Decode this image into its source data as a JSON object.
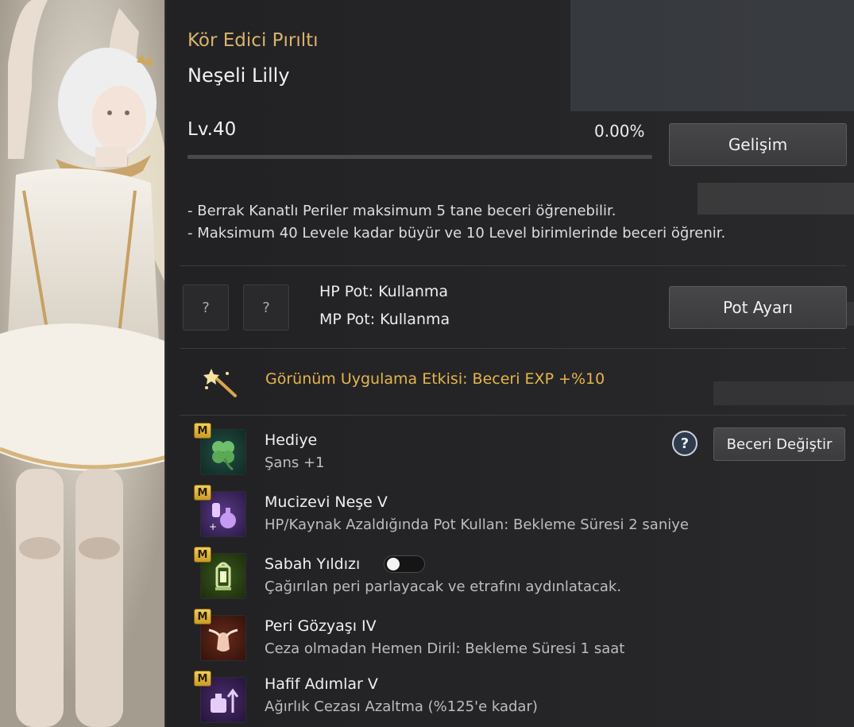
{
  "pet": {
    "title": "Kör Edici Pırıltı",
    "name": "Neşeli Lilly",
    "level": "Lv.40",
    "exp_percent": "0.00%",
    "exp_fraction": 0,
    "develop_button": "Gelişim"
  },
  "info": {
    "line1": "- Berrak Kanatlı Periler maksimum 5 tane beceri öğrenebilir.",
    "line2": "- Maksimum 40 Levele kadar büyür ve 10 Level birimlerinde beceri öğrenir."
  },
  "potions": {
    "hp_slot": "?",
    "mp_slot": "?",
    "hp_label": "HP Pot: Kullanma",
    "mp_label": "MP Pot: Kullanma",
    "settings_button": "Pot Ayarı"
  },
  "appearance_effect": "Görünüm Uygulama Etkisi: Beceri EXP +%10",
  "skills": {
    "change_button": "Beceri Değiştir",
    "help_glyph": "?",
    "badge": "M",
    "items": [
      {
        "name": "Hediye",
        "desc": "Şans +1",
        "icon": "clover-icon"
      },
      {
        "name": "Mucizevi Neşe V",
        "desc": "HP/Kaynak Azaldığında Pot Kullan: Bekleme Süresi 2 saniye",
        "icon": "potion-bottles-icon"
      },
      {
        "name": "Sabah Yıldızı",
        "desc": "Çağırılan peri parlayacak ve etrafını aydınlatacak.",
        "icon": "lantern-icon",
        "toggle": false
      },
      {
        "name": "Peri Gözyaşı IV",
        "desc": "Ceza olmadan Hemen Diril: Bekleme Süresi 1 saat",
        "icon": "winged-vase-icon"
      },
      {
        "name": "Hafif Adımlar V",
        "desc": "Ağırlık Cezası Azaltma (%125'e kadar)",
        "icon": "weight-arrow-icon"
      }
    ]
  },
  "colors": {
    "accent_gold": "#d9b46c",
    "effect_gold": "#e4b54c",
    "badge_gold": "#f1cc57"
  }
}
